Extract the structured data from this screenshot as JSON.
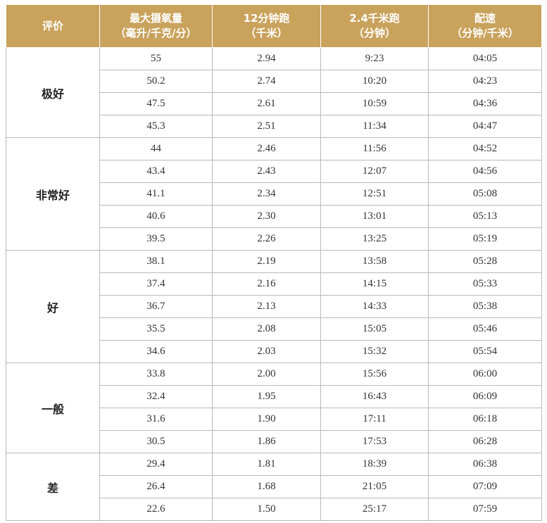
{
  "headers": [
    {
      "lines": [
        "评价"
      ]
    },
    {
      "lines": [
        "最大摄氧量",
        "（毫升/千克/分）"
      ]
    },
    {
      "lines": [
        "12分钟跑",
        "（千米）"
      ]
    },
    {
      "lines": [
        "2.4千米跑",
        "（分钟）"
      ]
    },
    {
      "lines": [
        "配速",
        "（分钟/千米）"
      ]
    }
  ],
  "groups": [
    {
      "rating": "极好",
      "rows": [
        [
          "55",
          "2.94",
          "9:23",
          "04:05"
        ],
        [
          "50.2",
          "2.74",
          "10:20",
          "04:23"
        ],
        [
          "47.5",
          "2.61",
          "10:59",
          "04:36"
        ],
        [
          "45.3",
          "2.51",
          "11:34",
          "04:47"
        ]
      ]
    },
    {
      "rating": "非常好",
      "rows": [
        [
          "44",
          "2.46",
          "11:56",
          "04:52"
        ],
        [
          "43.4",
          "2.43",
          "12:07",
          "04:56"
        ],
        [
          "41.1",
          "2.34",
          "12:51",
          "05:08"
        ],
        [
          "40.6",
          "2.30",
          "13:01",
          "05:13"
        ],
        [
          "39.5",
          "2.26",
          "13:25",
          "05:19"
        ]
      ]
    },
    {
      "rating": "好",
      "rows": [
        [
          "38.1",
          "2.19",
          "13:58",
          "05:28"
        ],
        [
          "37.4",
          "2.16",
          "14:15",
          "05:33"
        ],
        [
          "36.7",
          "2.13",
          "14:33",
          "05:38"
        ],
        [
          "35.5",
          "2.08",
          "15:05",
          "05:46"
        ],
        [
          "34.6",
          "2.03",
          "15:32",
          "05:54"
        ]
      ]
    },
    {
      "rating": "一般",
      "rows": [
        [
          "33.8",
          "2.00",
          "15:56",
          "06:00"
        ],
        [
          "32.4",
          "1.95",
          "16:43",
          "06:09"
        ],
        [
          "31.6",
          "1.90",
          "17:11",
          "06:18"
        ],
        [
          "30.5",
          "1.86",
          "17:53",
          "06:28"
        ]
      ]
    },
    {
      "rating": "差",
      "rows": [
        [
          "29.4",
          "1.81",
          "18:39",
          "06:38"
        ],
        [
          "26.4",
          "1.68",
          "21:05",
          "07:09"
        ],
        [
          "22.6",
          "1.50",
          "25:17",
          "07:59"
        ]
      ]
    }
  ],
  "colors": {
    "header_background": "#c9a25c",
    "header_text": "#ffffff",
    "grid_line": "#b9b9b9",
    "body_text": "#333333"
  }
}
